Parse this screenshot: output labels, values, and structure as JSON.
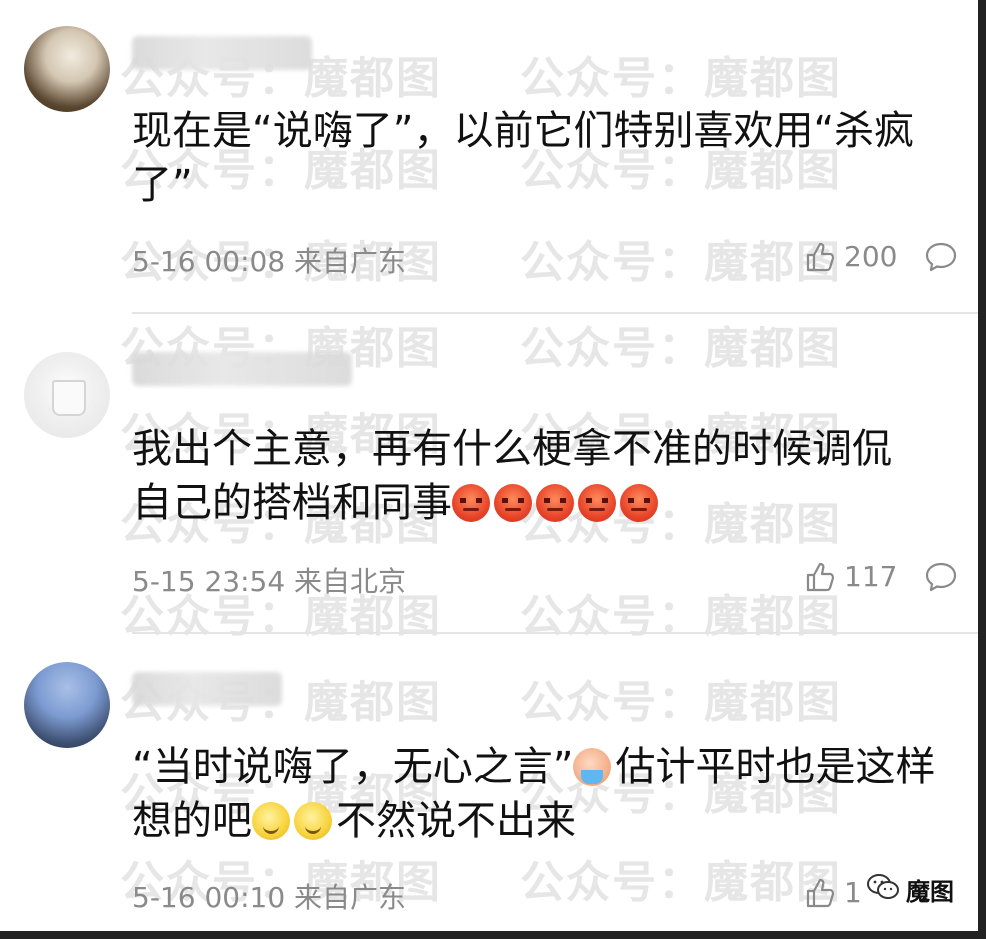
{
  "watermark": "公众号：魔都图",
  "brand_label": "魔图",
  "comments": [
    {
      "text_lines": [
        "现在是“说嗨了”，以前它们特别喜欢用“杀疯",
        "了”"
      ],
      "meta": "5-16 00:08 来自广东",
      "likes": "200",
      "emojis": []
    },
    {
      "text_lines": [
        "我出个主意，再有什么梗拿不准的时候调侃",
        "自己的搭档和同事"
      ],
      "meta": "5-15 23:54 来自北京",
      "likes": "117",
      "emojis": [
        "angry",
        "angry",
        "angry",
        "angry",
        "angry"
      ]
    },
    {
      "text_part1": "“当时说嗨了，无心之言”",
      "text_part2": "估计平时也是这样",
      "text_part3": "想的吧",
      "text_part4": "不然说不出来",
      "meta": "5-16 00:10 来自广东",
      "likes": "1"
    }
  ],
  "icons": {
    "like": "thumbs-up-icon",
    "reply": "comment-bubble-icon"
  },
  "colors": {
    "meta_text": "#8a8a8a",
    "body_text": "#111111",
    "divider": "#e4e4e4",
    "frame": "#222222"
  }
}
